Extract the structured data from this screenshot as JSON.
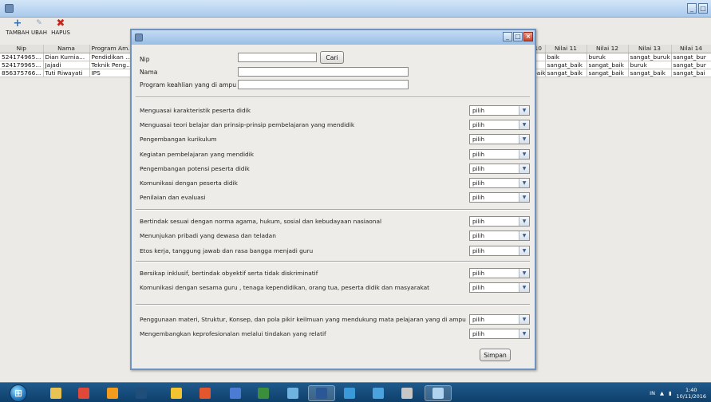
{
  "window": {
    "title": ""
  },
  "toolbar": {
    "tambah": "TAMBAH",
    "ubah": "UBAH",
    "hapus": "HAPUS"
  },
  "table": {
    "headers": [
      "Nip",
      "Nama",
      "Program Am..."
    ],
    "rows": [
      [
        "524174965...",
        "Dian Kurnia...",
        "Pendidikan ..."
      ],
      [
        "524179965...",
        "Jajadi",
        "Teknik Peng..."
      ],
      [
        "856375766...",
        "Tuti Riwayati",
        "IPS"
      ]
    ],
    "right_headers": [
      "10",
      "Nilai 11",
      "Nilai 12",
      "Nilai 13",
      "Nilai 14"
    ],
    "right_rows": [
      [
        "",
        "baik",
        "buruk",
        "sangat_buruk",
        "sangat_bur"
      ],
      [
        "",
        "sangat_baik",
        "sangat_baik",
        "buruk",
        "sangat_bur"
      ],
      [
        "baik",
        "sangat_baik",
        "sangat_baik",
        "sangat_baik",
        "sangat_bai"
      ]
    ]
  },
  "dialog": {
    "title": "",
    "nip_label": "Nip",
    "nip_value": "",
    "cari_button": "Cari",
    "nama_label": "Nama",
    "nama_value": "",
    "program_label": "Program keahlian yang di ampu",
    "program_value": "",
    "combo_default": "pilih",
    "criteria": [
      "Menguasai karakteristik peserta didik",
      "Menguasai teori belajar dan prinsip-prinsip pembelajaran yang mendidik",
      "Pengembangan kurikulum",
      "Kegiatan pembelajaran yang mendidik",
      "Pengembangan potensi peserta didik",
      "Komunikasi dengan peserta didik",
      "Penilaian dan evaluasi",
      "Bertindak sesuai dengan norma agama, hukum, sosial dan kebudayaan nasiaonal",
      "Menunjukan pribadi yang dewasa dan teladan",
      "Etos kerja, tanggung jawab dan rasa bangga menjadi guru",
      "Bersikap inklusif, bertindak obyektif serta tidak diskriminatif",
      "Komunikasi dengan sesama guru , tenaga kependidikan, orang tua, peserta didik dan masyarakat",
      "Penggunaan materi, Struktur, Konsep, dan pola pikir keilmuan yang mendukung mata pelajaran yang di ampu",
      "Mengembangkan keprofesionalan melalui tindakan yang relatif"
    ],
    "simpan_button": "Simpan"
  },
  "taskbar": {
    "apps": [
      "Windows Explorer",
      "Chrome",
      "Avast",
      "Photoshop",
      "Paint",
      "Mi",
      "Messaging",
      "Calculator",
      "Image Viewer",
      "Word",
      "Screen",
      "Virtual Box",
      "Files",
      "Java"
    ],
    "language": "IN",
    "time": "1:40",
    "date": "10/11/2016"
  },
  "colors": {
    "titlebar": "#a9c9ec",
    "dialog_border": "#6e93c1",
    "taskbar": "#0e3f6b",
    "delete_icon": "#c9261b",
    "add_icon": "#2f6fb1"
  }
}
